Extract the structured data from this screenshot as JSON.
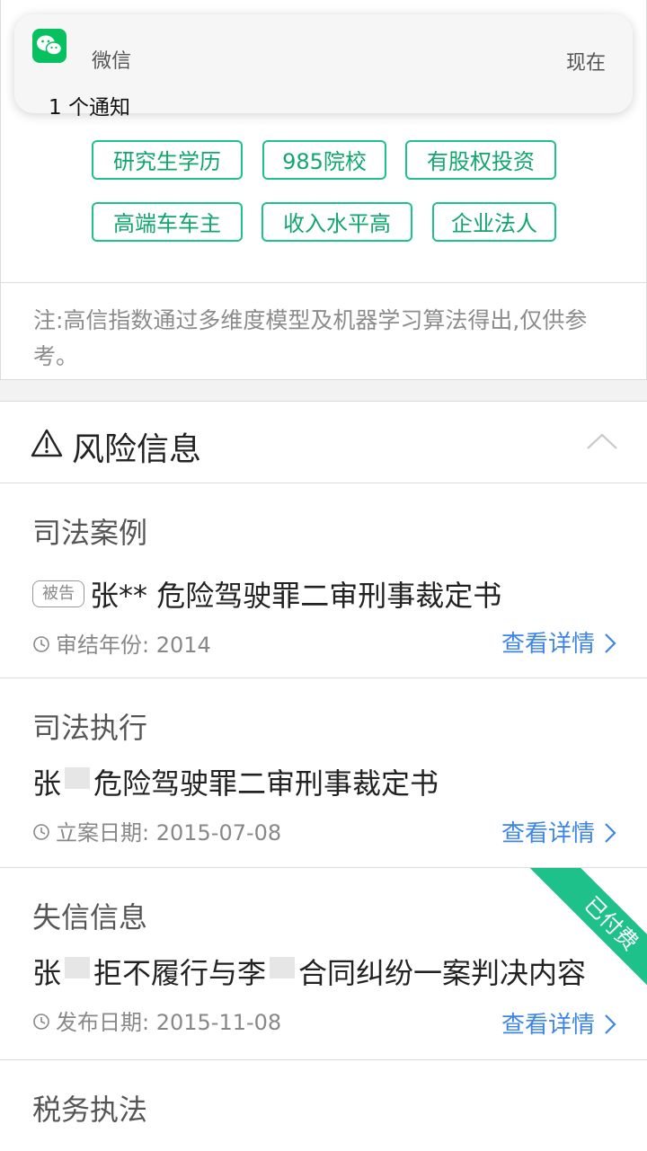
{
  "notification": {
    "app_name": "微信",
    "time": "现在",
    "message": "1 个通知"
  },
  "tags": [
    "研究生学历",
    "985院校",
    "有股权投资",
    "高端车车主",
    "收入水平高",
    "企业法人"
  ],
  "note": "注:高信指数通过多维度模型及机器学习算法得出,仅供参考。",
  "risk": {
    "title": "风险信息",
    "sections": [
      {
        "title": "司法案例",
        "badge": "被告",
        "case_prefix": "张**",
        "case_suffix": "危险驾驶罪二审刑事裁定书",
        "meta": "审结年份: 2014",
        "link": "查看详情"
      },
      {
        "title": "司法执行",
        "case_prefix": "张",
        "case_suffix": "危险驾驶罪二审刑事裁定书",
        "meta": "立案日期: 2015-07-08",
        "link": "查看详情"
      },
      {
        "title": "失信信息",
        "case_prefix": "张",
        "case_mid": "拒不履行与李",
        "case_suffix": "合同纠纷一案判决内容",
        "meta": "发布日期: 2015-11-08",
        "link": "查看详情",
        "ribbon": "已付费"
      },
      {
        "title": "税务执法"
      }
    ]
  },
  "colors": {
    "accent_green": "#1fc18a",
    "link_blue": "#3d86e6",
    "wechat_green": "#07c160"
  }
}
